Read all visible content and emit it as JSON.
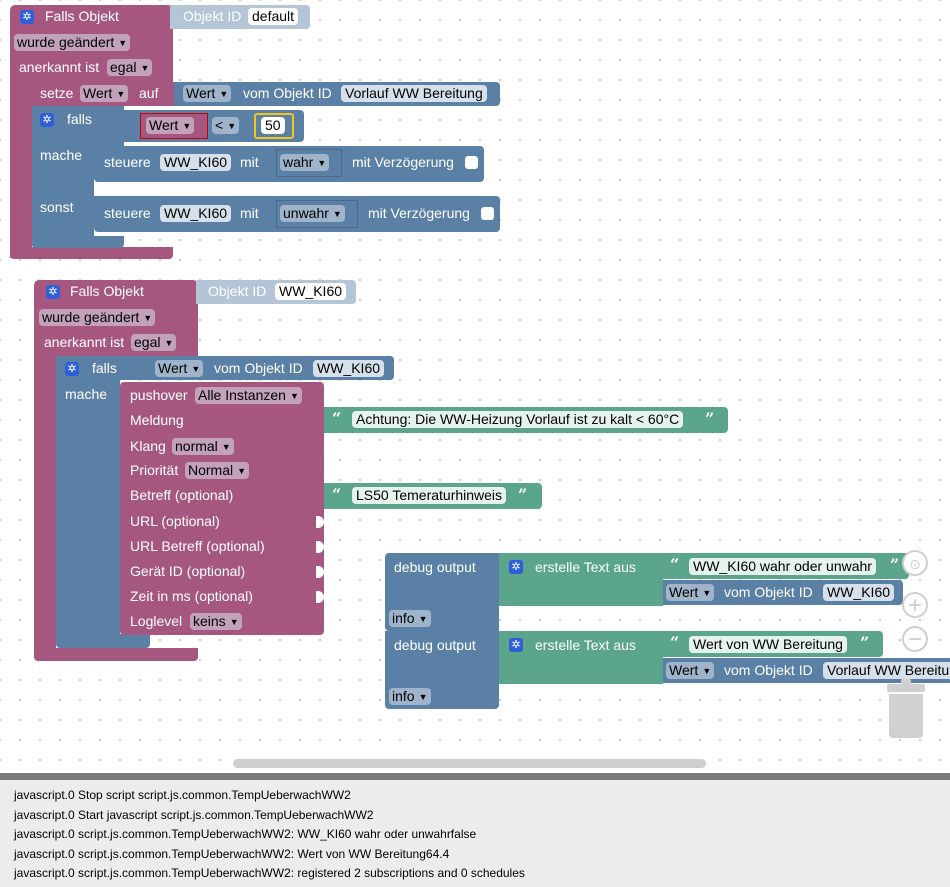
{
  "colors": {
    "purple": "#a5577f",
    "blue": "#5b80a5",
    "green": "#5ba58c",
    "console_bg": "#ececec"
  },
  "block1": {
    "header": "Falls Objekt",
    "objid_label": "Objekt ID",
    "objid_value": "default",
    "changed": "wurde geändert",
    "ack_label": "anerkannt ist",
    "ack_value": "egal",
    "set_label": "setze",
    "set_var": "Wert",
    "set_on": "auf",
    "set_value": "Wert",
    "set_from": "vom Objekt ID",
    "set_objid": "Vorlauf WW Bereitung",
    "if_label": "falls",
    "cmp_left": "Wert",
    "cmp_op": "<",
    "cmp_right": "50",
    "do_label": "mache",
    "else_label": "sonst",
    "ctrl1": {
      "label": "steuere",
      "obj": "WW_KI60",
      "with": "mit",
      "value": "wahr",
      "delay": "mit Verzögerung"
    },
    "ctrl2": {
      "label": "steuere",
      "obj": "WW_KI60",
      "with": "mit",
      "value": "unwahr",
      "delay": "mit Verzögerung"
    }
  },
  "block2": {
    "header": "Falls Objekt",
    "objid_label": "Objekt ID",
    "objid_value": "WW_KI60",
    "changed": "wurde geändert",
    "ack_label": "anerkannt ist",
    "ack_value": "egal",
    "if_label": "falls",
    "if_value": "Wert",
    "if_from": "vom Objekt ID",
    "if_objid": "WW_KI60",
    "do_label": "mache",
    "pushover": {
      "label": "pushover",
      "instance": "Alle Instanzen",
      "meldung": "Meldung",
      "meldung_text": "Achtung: Die WW-Heizung Vorlauf ist zu kalt < 60°C",
      "klang": "Klang",
      "klang_value": "normal",
      "prio": "Priorität",
      "prio_value": "Normal",
      "betreff": "Betreff (optional)",
      "betreff_text": "LS50 Temeraturhinweis",
      "url": "URL (optional)",
      "url_betreff": "URL Betreff (optional)",
      "device": "Gerät ID (optional)",
      "time": "Zeit in ms (optional)",
      "loglevel": "Loglevel",
      "loglevel_value": "keins"
    }
  },
  "debug1": {
    "label": "debug output",
    "create": "erstelle Text aus",
    "text": "WW_KI60 wahr oder unwahr",
    "value": "Wert",
    "from": "vom Objekt ID",
    "objid": "WW_KI60",
    "level": "info"
  },
  "debug2": {
    "label": "debug output",
    "create": "erstelle Text aus",
    "text": "Wert von WW Bereitung",
    "value": "Wert",
    "from": "vom Objekt ID",
    "objid": "Vorlauf WW Bereitung",
    "level": "info"
  },
  "console": [
    "javascript.0 Stop script script.js.common.TempUeberwachWW2",
    "javascript.0 Start javascript script.js.common.TempUeberwachWW2",
    "javascript.0 script.js.common.TempUeberwachWW2: WW_KI60 wahr oder unwahrfalse",
    "javascript.0 script.js.common.TempUeberwachWW2: Wert von WW Bereitung64.4",
    "javascript.0 script.js.common.TempUeberwachWW2: registered 2 subscriptions and 0 schedules"
  ]
}
